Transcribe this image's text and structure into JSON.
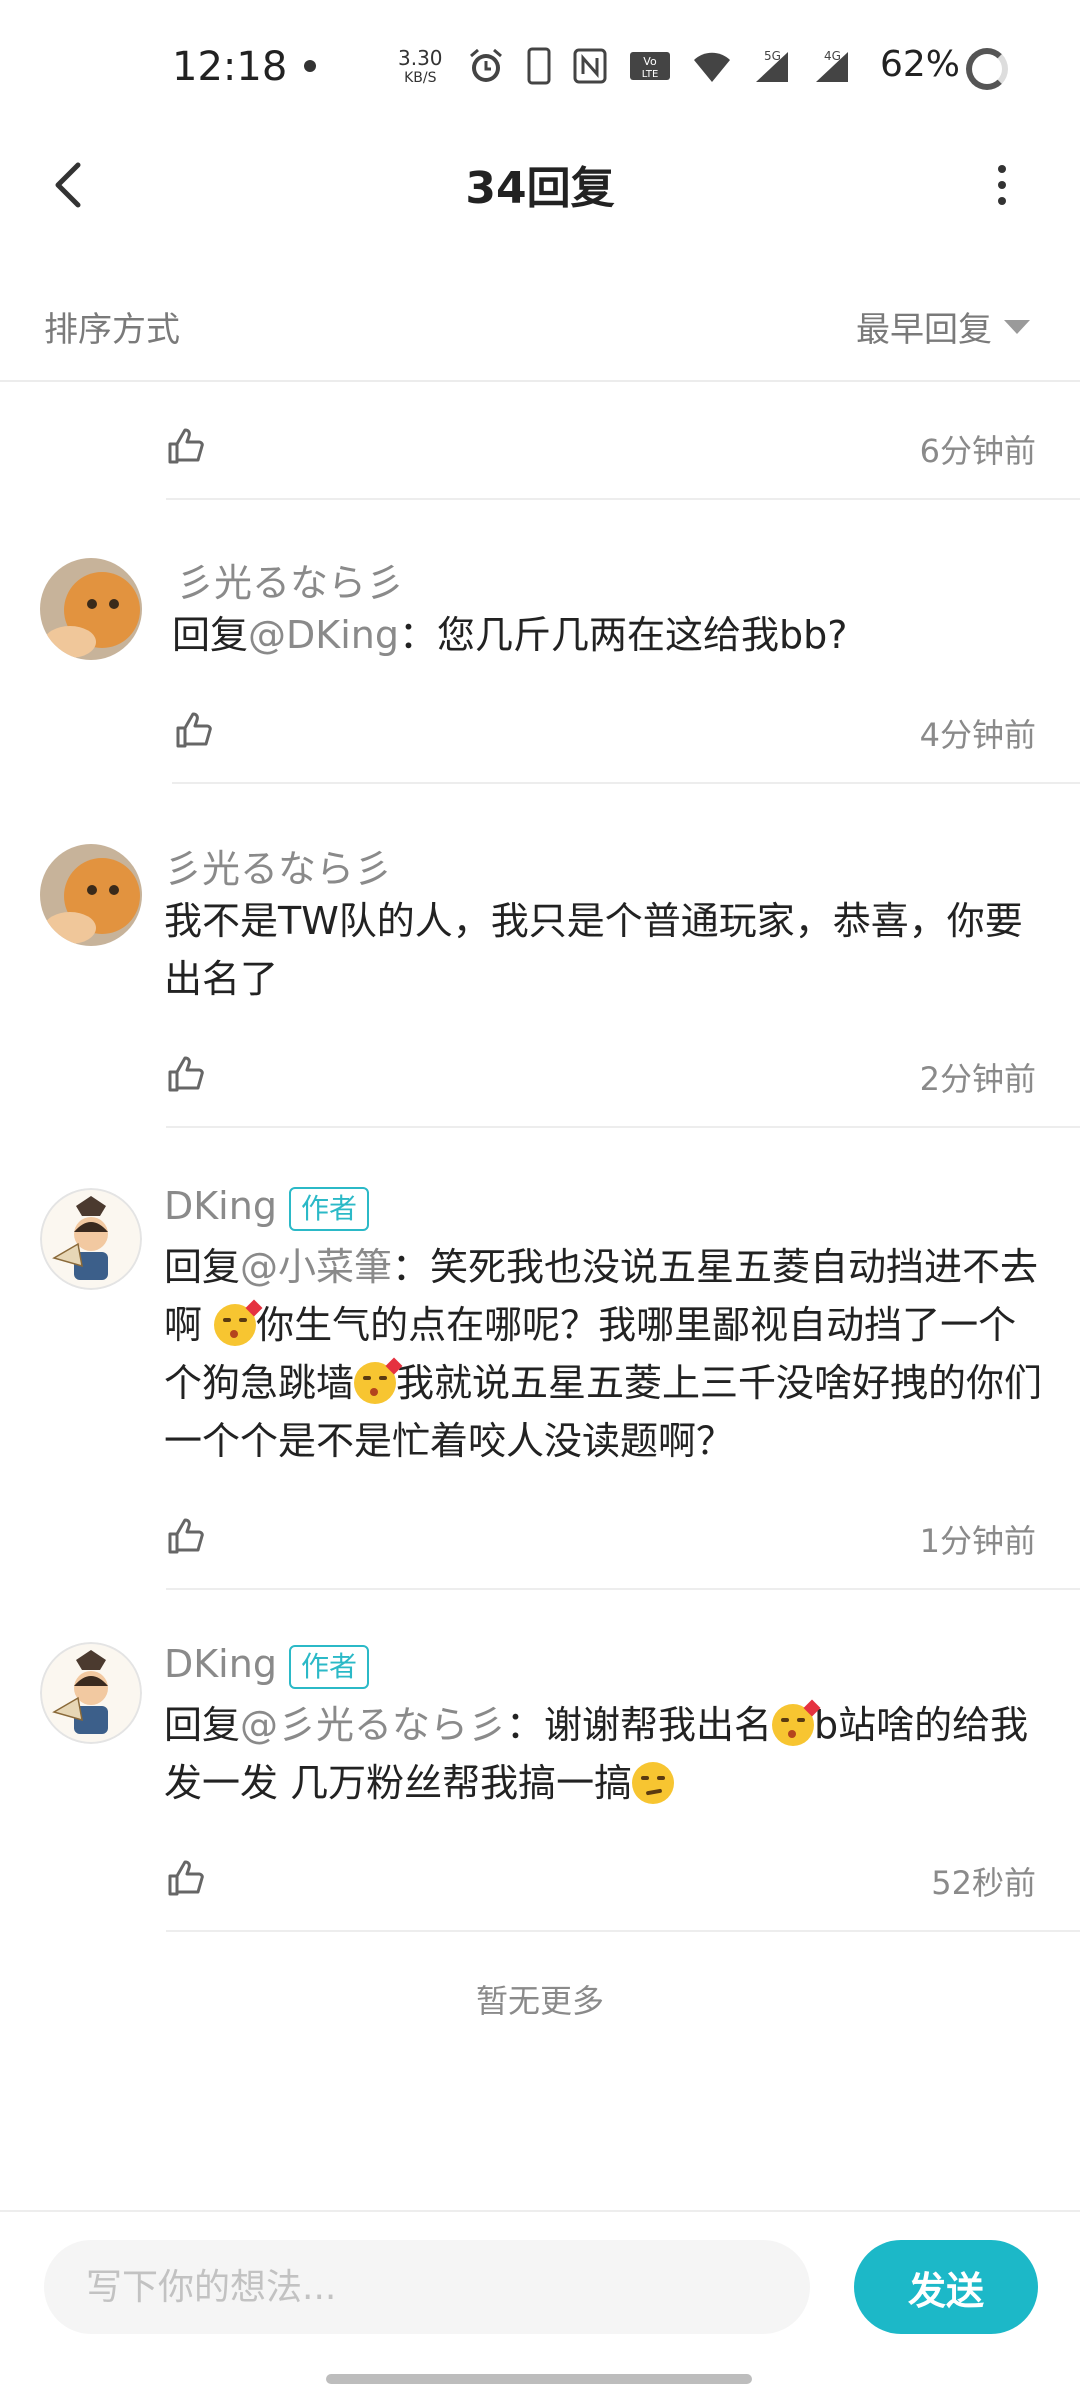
{
  "status_bar": {
    "time": "12:18",
    "net_speed_value": "3.30",
    "net_speed_unit": "KB/S",
    "battery": "62%",
    "icons": [
      "alarm-icon",
      "vibrate-icon",
      "nfc-icon",
      "volte-icon",
      "wifi-icon",
      "signal-5g-icon",
      "signal-4g-icon"
    ]
  },
  "header": {
    "title": "34回复"
  },
  "sort": {
    "label": "排序方式",
    "selected": "最早回复"
  },
  "replies": [
    {
      "time": "6分钟前"
    },
    {
      "user": "彡光るなら彡",
      "prefix": "回复",
      "mention": "@DKing",
      "text": "：您几斤几两在这给我bb?",
      "time": "4分钟前"
    },
    {
      "user": "彡光るなら彡",
      "text": "我不是TW队的人，我只是个普通玩家，恭喜，你要出名了",
      "time": "2分钟前"
    },
    {
      "user": "DKing",
      "badge": "作者",
      "prefix": "回复",
      "mention": "@小菜筆",
      "text_a": "：笑死我也没说五星五菱自动挡进不去啊 ",
      "text_b": "你生气的点在哪呢？我哪里鄙视自动挡了一个个狗急跳墙",
      "text_c": "我就说五星五菱上三千没啥好拽的你们一个个是不是忙着咬人没读题啊？",
      "time": "1分钟前"
    },
    {
      "user": "DKing",
      "badge": "作者",
      "prefix": "回复",
      "mention": "@彡光るなら彡",
      "text_a": "：谢谢帮我出名",
      "text_b": "b站啥的给我发一发 几万粉丝帮我搞一搞",
      "time": "52秒前"
    }
  ],
  "footer_text": "暂无更多",
  "input": {
    "placeholder": "写下你的想法...",
    "send_label": "发送"
  },
  "colors": {
    "accent": "#1cb8c8",
    "secondary_text": "#8a8a8a"
  }
}
